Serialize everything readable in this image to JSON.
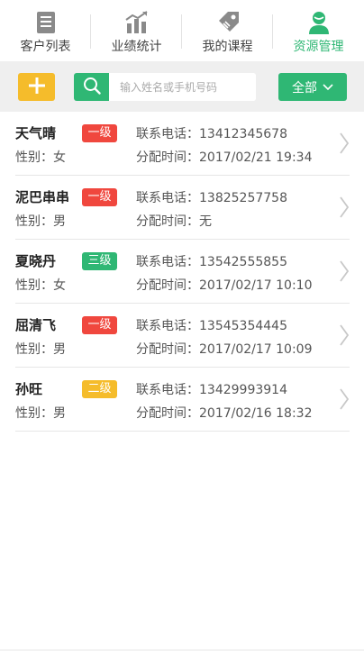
{
  "nav": {
    "tabs": [
      {
        "label": "客户列表",
        "icon": "document-list-icon",
        "active": false
      },
      {
        "label": "业绩统计",
        "icon": "bar-chart-icon",
        "active": false
      },
      {
        "label": "我的课程",
        "icon": "tag-icon",
        "active": false
      },
      {
        "label": "资源管理",
        "icon": "user-profile-icon",
        "active": true
      }
    ]
  },
  "toolbar": {
    "add_icon": "plus-icon",
    "search_icon": "search-icon",
    "search_placeholder": "输入姓名或手机号码",
    "search_value": "",
    "filter_label": "全部",
    "filter_icon": "chevron-down-icon"
  },
  "colors": {
    "accent_green": "#2fb774",
    "add_yellow": "#f5bc2b",
    "level_red": "#f0473e",
    "level_green": "#2fb774",
    "level_yellow": "#f5bc2b"
  },
  "customers": [
    {
      "name": "天气晴",
      "gender": "性别：女",
      "level": "一级",
      "level_color": "#f0473e",
      "phone": "联系电话：13412345678",
      "assigned": "分配时间：2017/02/21 19:34"
    },
    {
      "name": "泥巴串串",
      "gender": "性别：男",
      "level": "一级",
      "level_color": "#f0473e",
      "phone": "联系电话：13825257758",
      "assigned": "分配时间：无"
    },
    {
      "name": "夏晓丹",
      "gender": "性别：女",
      "level": "三级",
      "level_color": "#2fb774",
      "phone": "联系电话：13542555855",
      "assigned": "分配时间：2017/02/17 10:10"
    },
    {
      "name": "屈清飞",
      "gender": "性别：男",
      "level": "一级",
      "level_color": "#f0473e",
      "phone": "联系电话：13545354445",
      "assigned": "分配时间：2017/02/17 10:09"
    },
    {
      "name": "孙旺",
      "gender": "性别：男",
      "level": "二级",
      "level_color": "#f5bc2b",
      "phone": "联系电话：13429993914",
      "assigned": "分配时间：2017/02/16 18:32"
    }
  ]
}
